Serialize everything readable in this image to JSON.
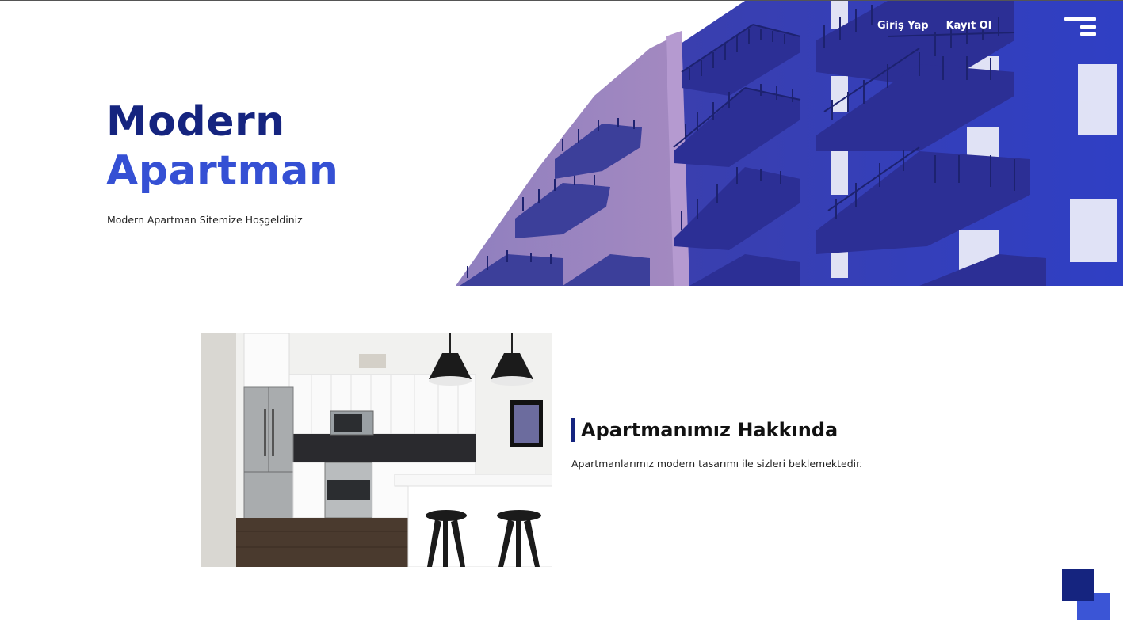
{
  "hero": {
    "title_line1": "Modern",
    "title_line2": "Apartman",
    "subtitle": "Modern Apartman Sitemize Hoşgeldiniz"
  },
  "nav": {
    "login_label": "Giriş Yap",
    "register_label": "Kayıt Ol"
  },
  "about": {
    "title": "Apartmanımız Hakkında",
    "text": "Apartmanlarımız modern tasarımı ile sizleri beklemektedir."
  },
  "icons": {
    "menu": "hamburger-menu-icon",
    "back_to_top": "back-to-top-squares"
  },
  "colors": {
    "primary_dark": "#15247f",
    "primary": "#3550d4",
    "hero_photo_tint": "#3a45b8"
  }
}
